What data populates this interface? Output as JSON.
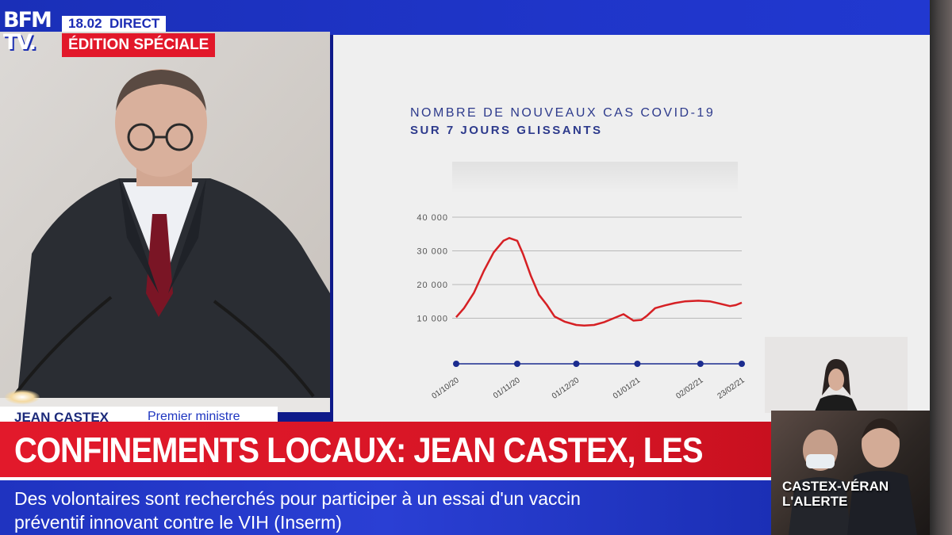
{
  "channel": {
    "logo_line1": "BFM",
    "logo_line2": "TV.",
    "time": "18.02",
    "live": "DIRECT",
    "edition": "ÉDITION SPÉCIALE"
  },
  "slide": {
    "title": "NOMBRE DE NOUVEAUX CAS COVID-19",
    "subtitle": "SUR 7 JOURS GLISSANTS"
  },
  "chart_data": {
    "type": "line",
    "title": "NOMBRE DE NOUVEAUX CAS COVID-19",
    "subtitle": "SUR 7 JOURS GLISSANTS",
    "xlabel": "",
    "ylabel": "",
    "ylim": [
      0,
      40000
    ],
    "yticks": [
      "10 000",
      "20 000",
      "30 000",
      "40 000"
    ],
    "xtick_labels": [
      "01/10/20",
      "01/11/20",
      "01/12/20",
      "01/01/21",
      "02/02/21",
      "23/02/21"
    ],
    "grid": "horizontal",
    "line_color": "#d62024",
    "marker_color": "#1b2c8f",
    "series": [
      {
        "name": "",
        "x": [
          "01/10/20",
          "05/10/20",
          "10/10/20",
          "15/10/20",
          "20/10/20",
          "25/10/20",
          "28/10/20",
          "01/11/20",
          "04/11/20",
          "08/11/20",
          "12/11/20",
          "16/11/20",
          "20/11/20",
          "25/11/20",
          "01/12/20",
          "05/12/20",
          "10/12/20",
          "15/12/20",
          "20/12/20",
          "25/12/20",
          "30/12/20",
          "03/01/21",
          "06/01/21",
          "10/01/21",
          "15/01/21",
          "20/01/21",
          "25/01/21",
          "01/02/21",
          "07/02/21",
          "12/02/21",
          "17/02/21",
          "20/02/21",
          "23/02/21"
        ],
        "y": [
          10300,
          13000,
          17500,
          24000,
          29500,
          33000,
          33800,
          33000,
          29000,
          22500,
          17000,
          14000,
          10500,
          9000,
          8000,
          7800,
          8000,
          8800,
          10000,
          11200,
          9300,
          9500,
          10800,
          13000,
          13800,
          14500,
          15000,
          15200,
          15000,
          14300,
          13600,
          13900,
          14600
        ]
      }
    ]
  },
  "lower_third": {
    "name": "JEAN CASTEX",
    "role": "Premier ministre",
    "headline": "CONFINEMENTS LOCAUX: JEAN CASTEX, LES ANNONCES",
    "ticker_line1": "Des volontaires sont recherchés pour participer à un essai d'un vaccin",
    "ticker_line2": "préventif innovant contre le VIH  (Inserm)"
  },
  "promo": {
    "line1": "CASTEX-VÉRAN",
    "line2": "L'ALERTE"
  },
  "colors": {
    "brand_blue": "#1f35c9",
    "alert_red": "#e2182a"
  }
}
